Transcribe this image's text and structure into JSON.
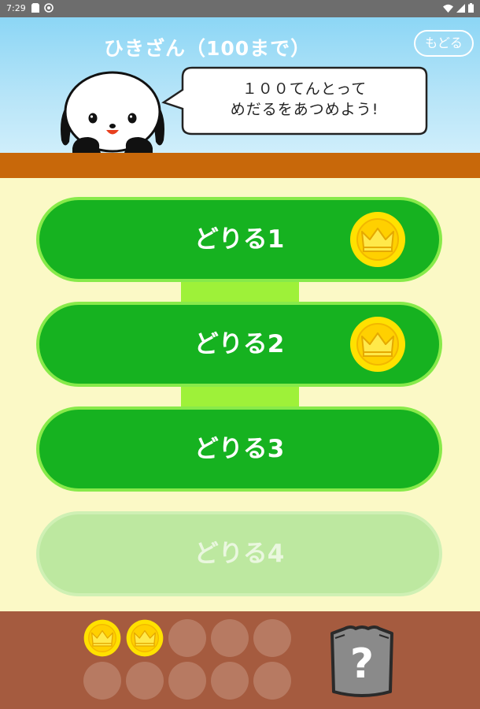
{
  "status_bar": {
    "time": "7:29"
  },
  "header": {
    "title": "ひきざん（100まで）",
    "back_label": "もどる",
    "speech_line1": "１００てんとって",
    "speech_line2": "めだるをあつめよう!"
  },
  "drills": [
    {
      "label": "どりる1",
      "earned_medal": true,
      "enabled": true
    },
    {
      "label": "どりる2",
      "earned_medal": true,
      "enabled": true
    },
    {
      "label": "どりる3",
      "earned_medal": false,
      "enabled": true
    },
    {
      "label": "どりる4",
      "earned_medal": false,
      "enabled": false
    }
  ],
  "medals": {
    "total": 10,
    "collected": 2
  },
  "mystery_prize": {
    "glyph": "?"
  },
  "colors": {
    "drill_green": "#16b220",
    "drill_border": "#87ea4a",
    "connector": "#9ef139",
    "coin_gold": "#ffd900",
    "panel_brown": "#a55b3f",
    "dirt": "#c8680a",
    "background": "#fbf9c6"
  }
}
